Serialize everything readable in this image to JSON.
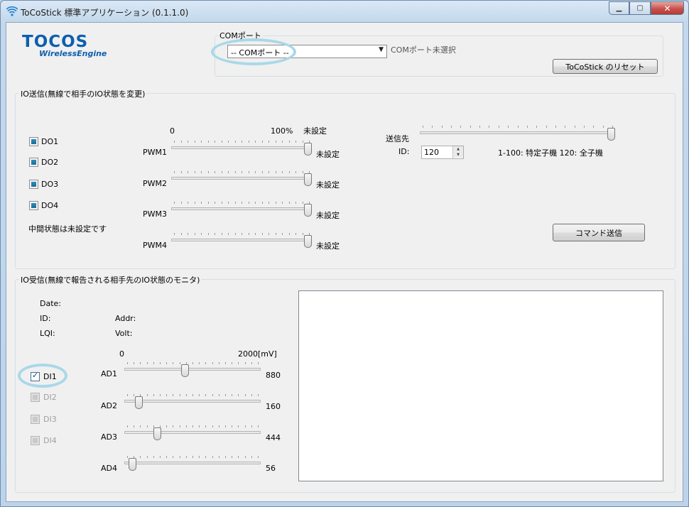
{
  "window": {
    "title": "ToCoStick 標準アプリケーション (0.1.1.0)",
    "minimize": "▁",
    "maximize": "▢",
    "close": "✕"
  },
  "logo": {
    "main": "TOCOS",
    "sub": "WirelessEngine"
  },
  "com": {
    "group_label": "COMポート",
    "combo_value": "-- COMポート --",
    "status": "COMポート未選択",
    "reset_button": "ToCoStick のリセット"
  },
  "io_send": {
    "group_label": "IO送信(無線で相手のIO状態を変更)",
    "do_items": [
      {
        "label": "DO1",
        "state": "indeterminate"
      },
      {
        "label": "DO2",
        "state": "indeterminate"
      },
      {
        "label": "DO3",
        "state": "indeterminate"
      },
      {
        "label": "DO4",
        "state": "indeterminate"
      }
    ],
    "note": "中間状態は未設定です",
    "pwm_scale_min": "0",
    "pwm_scale_max": "100%",
    "pwm_header_status": "未設定",
    "pwm": [
      {
        "label": "PWM1",
        "status": "未設定",
        "level_percent": 100
      },
      {
        "label": "PWM2",
        "status": "未設定",
        "level_percent": 100
      },
      {
        "label": "PWM3",
        "status": "未設定",
        "level_percent": 100
      },
      {
        "label": "PWM4",
        "status": "未設定",
        "level_percent": 100
      }
    ],
    "dest_label": "送信先",
    "dest_slider_level_percent": 100,
    "id_label": "ID:",
    "id_value": "120",
    "id_hint": "1-100: 特定子機 120: 全子機",
    "send_button": "コマンド送信"
  },
  "io_recv": {
    "group_label": "IO受信(無線で報告される相手先のIO状態のモニタ)",
    "date_label": "Date:",
    "id_label": "ID:",
    "lqi_label": "LQI:",
    "addr_label": "Addr:",
    "volt_label": "Volt:",
    "ad_scale_min": "0",
    "ad_scale_max": "2000[mV]",
    "di_items": [
      {
        "label": "DI1",
        "checked": true,
        "enabled": true
      },
      {
        "label": "DI2",
        "checked": false,
        "enabled": false
      },
      {
        "label": "DI3",
        "checked": false,
        "enabled": false
      },
      {
        "label": "DI4",
        "checked": false,
        "enabled": false
      }
    ],
    "ad": [
      {
        "label": "AD1",
        "value": "880",
        "mv": 880
      },
      {
        "label": "AD2",
        "value": "160",
        "mv": 160
      },
      {
        "label": "AD3",
        "value": "444",
        "mv": 444
      },
      {
        "label": "AD4",
        "value": "56",
        "mv": 56
      }
    ],
    "ad_max_mv": 2000
  },
  "colors": {
    "logo": "#0d5fb0",
    "highlight": "#a9d8e8",
    "checkbox_fill": "#1d6d99"
  }
}
